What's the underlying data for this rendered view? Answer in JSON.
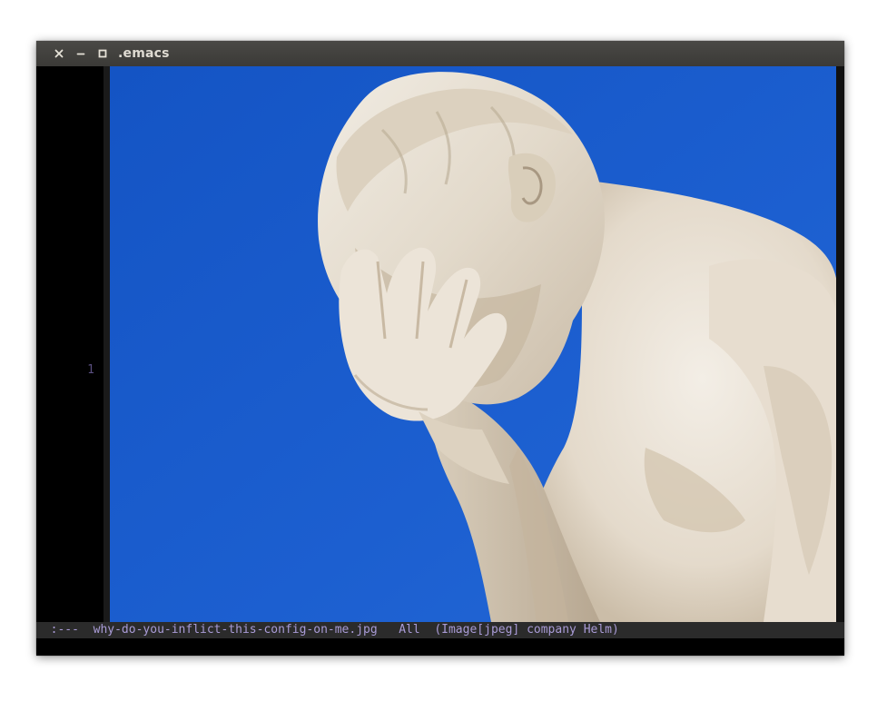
{
  "window": {
    "title": ".emacs",
    "controls": [
      "close-icon",
      "minimize-icon",
      "maximize-icon"
    ]
  },
  "buffer": {
    "line_numbers": [
      "1"
    ],
    "image_description_icon": "facepalm-statue-image"
  },
  "modeline": {
    "status": ":---",
    "buffer_name": "why-do-you-inflict-this-config-on-me.jpg",
    "position": "All",
    "modes": "(Image[jpeg] company Helm)"
  },
  "colors": {
    "titlebar": "#3f3e3b",
    "sky": "#1a5bc8",
    "modeline_bg": "#2b2b2b",
    "modeline_fg": "#a99bd6",
    "line_number": "#5a4f80"
  }
}
